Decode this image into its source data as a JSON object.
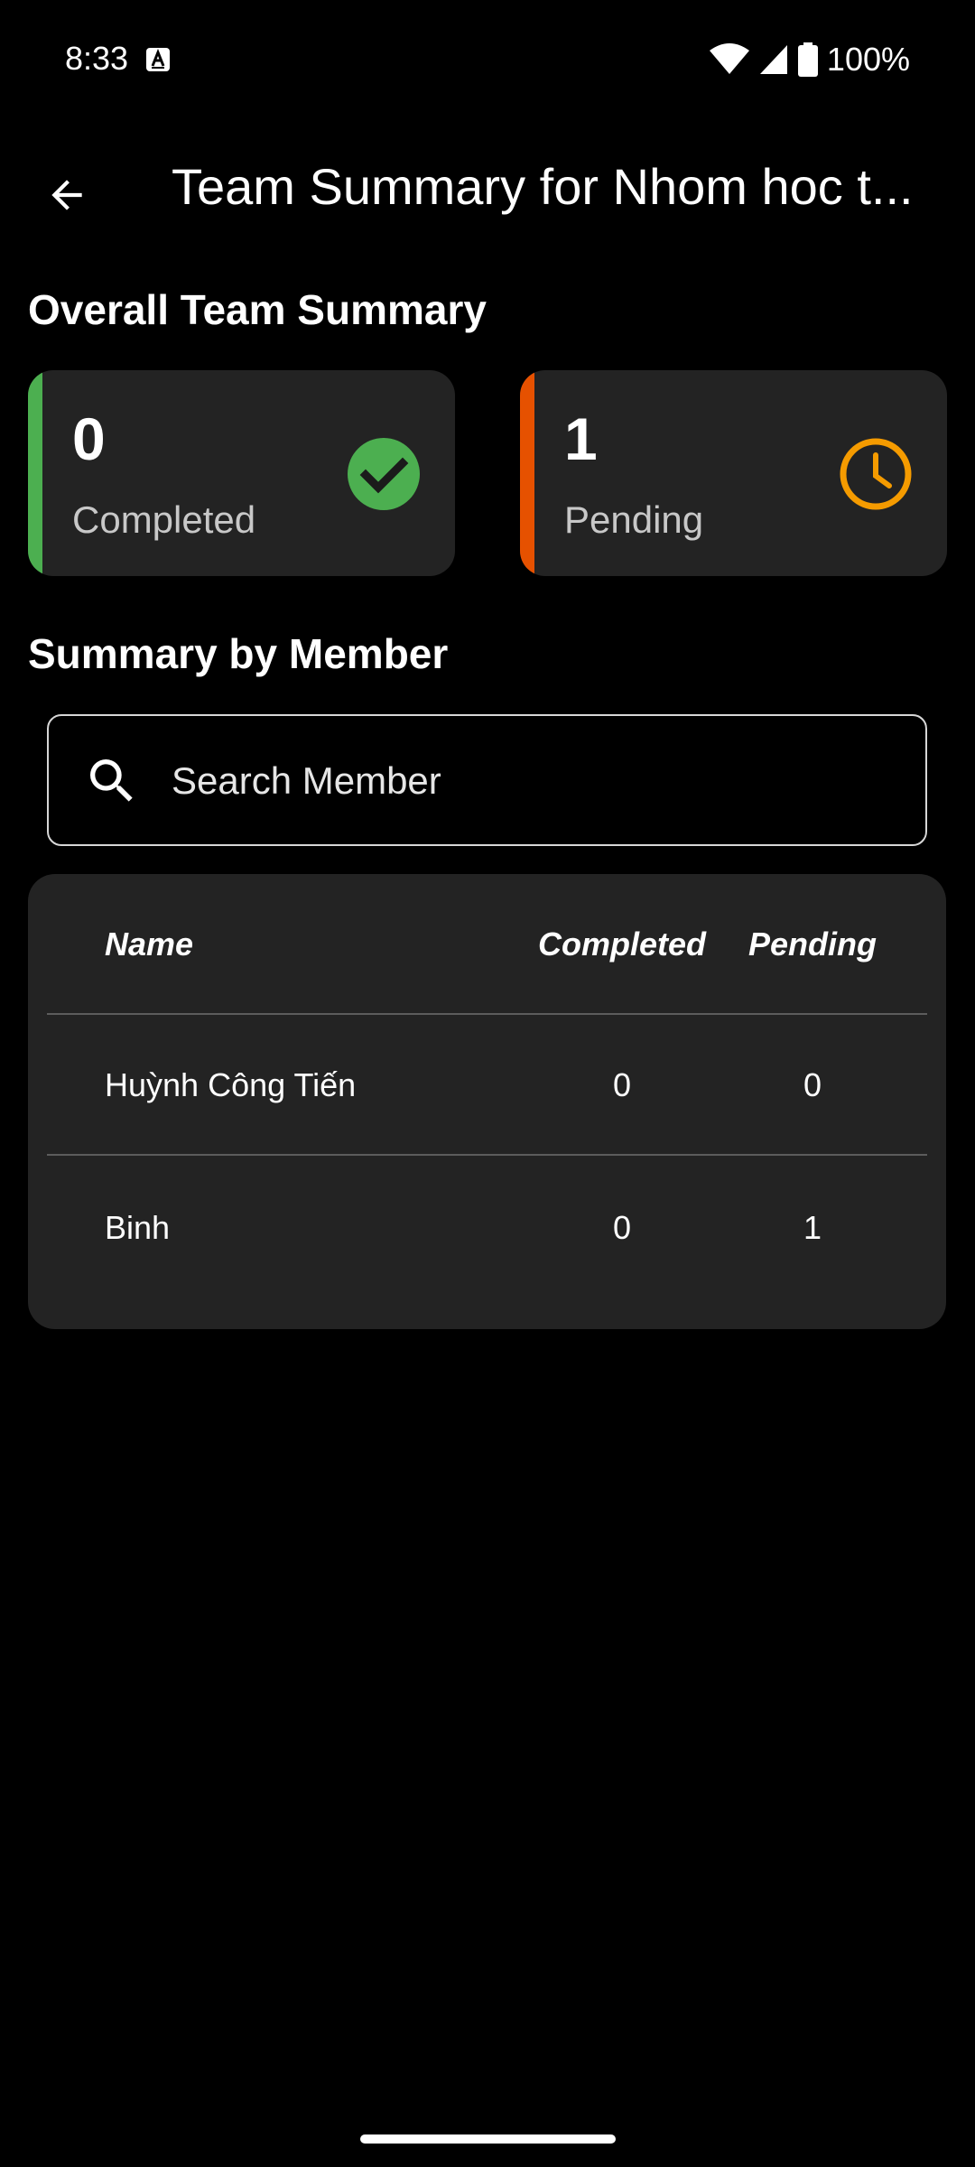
{
  "status_bar": {
    "time": "8:33",
    "battery": "100%",
    "icons": [
      "a-notification-icon",
      "wifi-icon",
      "cell-signal-icon",
      "battery-icon"
    ]
  },
  "app_bar": {
    "back_icon": "arrow-left-icon",
    "title": "Team Summary for Nhom hoc t..."
  },
  "overall": {
    "section_title": "Overall Team Summary",
    "completed": {
      "value": "0",
      "label": "Completed",
      "accent": "#4CAF50",
      "icon": "check-circle-icon"
    },
    "pending": {
      "value": "1",
      "label": "Pending",
      "accent": "#E65100",
      "icon_color": "#F59B00",
      "icon": "clock-icon"
    }
  },
  "by_member": {
    "section_title": "Summary by Member",
    "search": {
      "placeholder": "Search Member",
      "value": ""
    },
    "table": {
      "headers": {
        "name": "Name",
        "completed": "Completed",
        "pending": "Pending"
      },
      "rows": [
        {
          "name": "Huỳnh Công Tiến",
          "completed": "0",
          "pending": "0"
        },
        {
          "name": "Binh",
          "completed": "0",
          "pending": "1"
        }
      ]
    }
  }
}
